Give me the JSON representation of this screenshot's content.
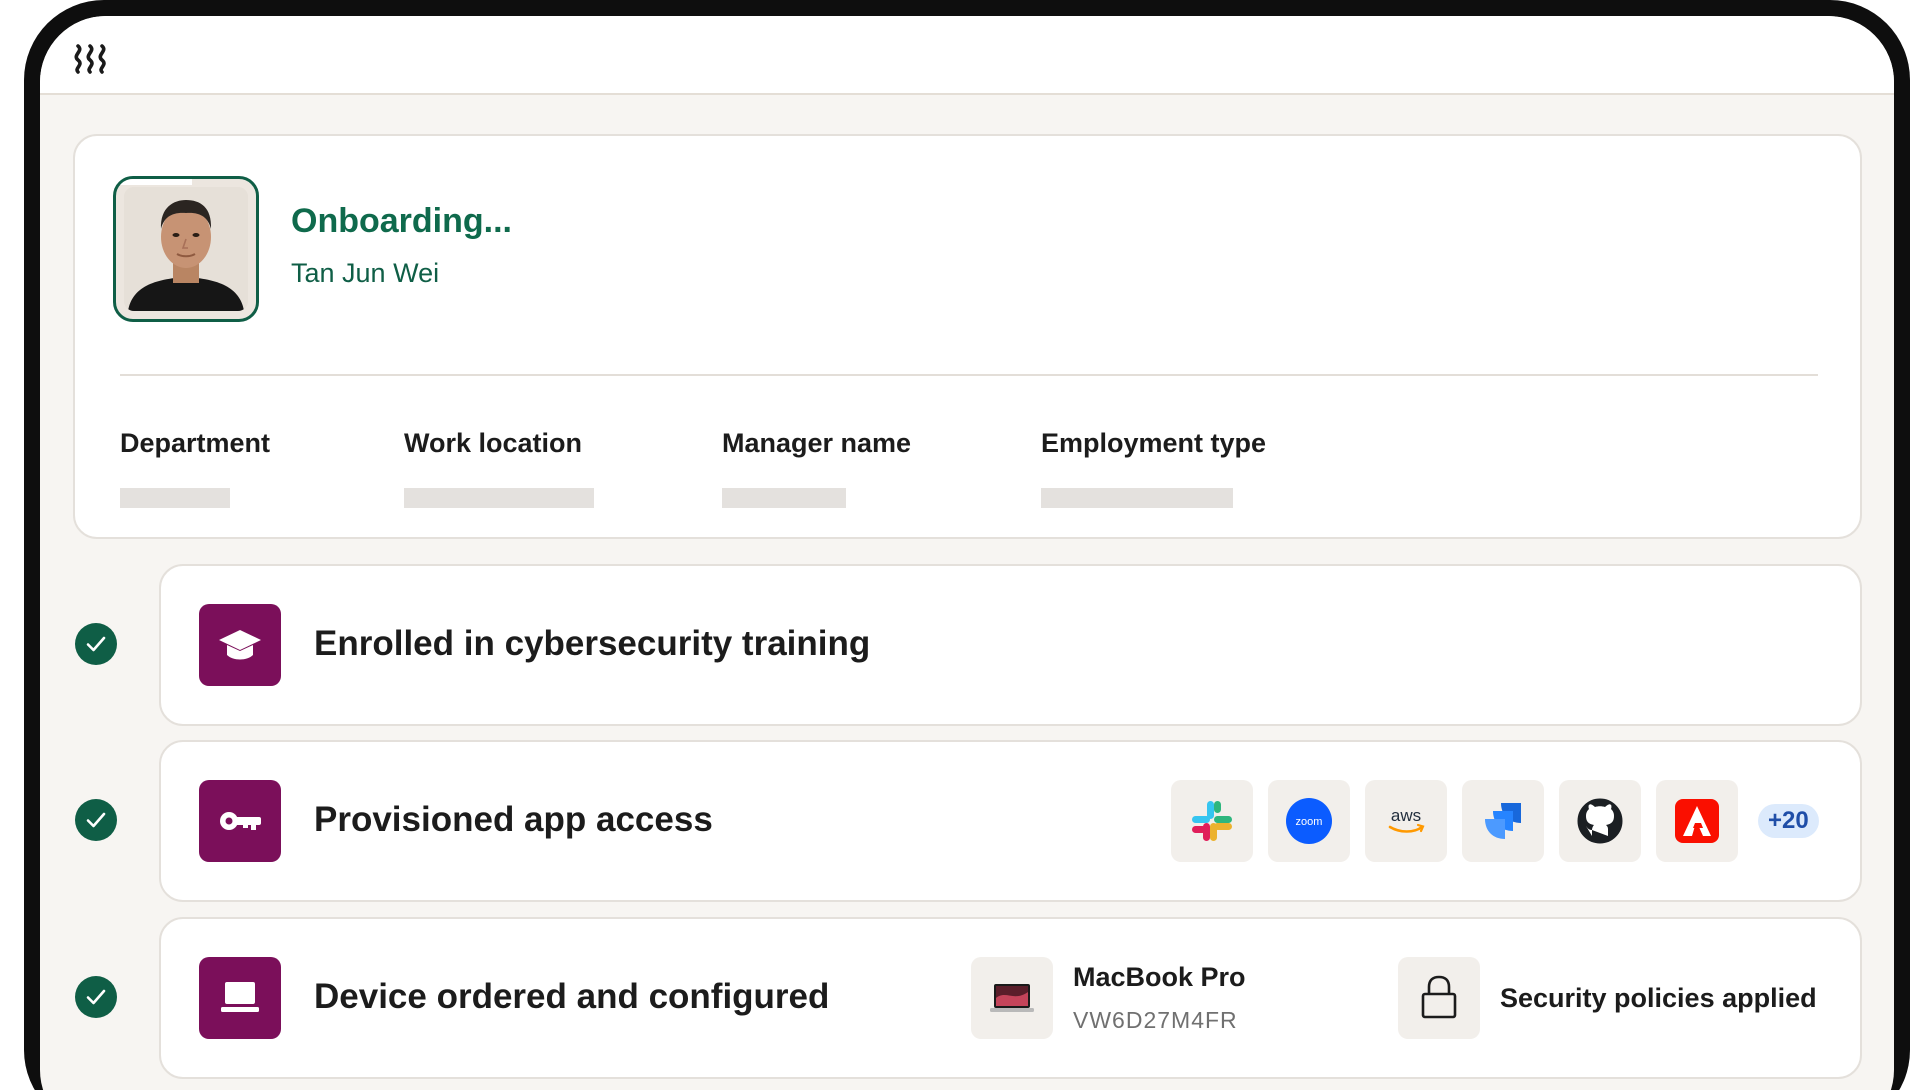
{
  "logo": {
    "icon": "waves-logo-icon"
  },
  "profile": {
    "status": "Onboarding...",
    "name": "Tan Jun Wei",
    "fields": [
      {
        "label": "Department"
      },
      {
        "label": "Work location"
      },
      {
        "label": "Manager name"
      },
      {
        "label": "Employment type"
      }
    ]
  },
  "tasks": [
    {
      "title": "Enrolled in cybersecurity training",
      "icon": "graduation-cap-icon",
      "status": "complete"
    },
    {
      "title": "Provisioned app access",
      "icon": "key-icon",
      "status": "complete",
      "apps": [
        {
          "name": "slack",
          "icon": "slack-icon"
        },
        {
          "name": "zoom",
          "label": "zoom",
          "icon": "zoom-icon"
        },
        {
          "name": "aws",
          "label": "aws",
          "icon": "aws-icon"
        },
        {
          "name": "jira",
          "icon": "jira-icon"
        },
        {
          "name": "github",
          "icon": "github-icon"
        },
        {
          "name": "adobe",
          "icon": "adobe-icon"
        }
      ],
      "more_count": "+20"
    },
    {
      "title": "Device ordered and configured",
      "icon": "laptop-icon",
      "status": "complete",
      "device": {
        "name": "MacBook Pro",
        "serial": "VW6D27M4FR",
        "icon": "macbook-icon"
      },
      "policy": {
        "label": "Security policies applied",
        "icon": "lock-icon"
      }
    }
  ],
  "colors": {
    "brand_green": "#0f5e46",
    "task_purple": "#7b0f5a",
    "badge_blue": "#dceafc"
  }
}
